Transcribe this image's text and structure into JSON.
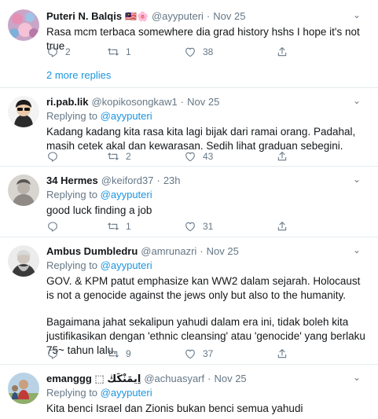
{
  "tweets": [
    {
      "name": "Puteri N. Balqis",
      "flags": "🇲🇾🌸",
      "handle": "@ayyputeri",
      "time": "Nov 25",
      "reply_label": "",
      "reply_to": "",
      "text": [
        "Rasa mcm terbaca somewhere dia grad history hshs I hope it's not true"
      ],
      "replies": "2",
      "retweets": "1",
      "likes": "38"
    },
    {
      "name": "ri.pab.lik",
      "handle": "@kopikosongkaw1",
      "time": "Nov 25",
      "reply_label": "Replying to",
      "reply_to": "@ayyputeri",
      "text": [
        "Kadang kadang kita rasa kita lagi bijak dari ramai orang. Padahal, masih cetek akal dan kewarasan. Sedih lihat graduan sebegini."
      ],
      "replies": "",
      "retweets": "2",
      "likes": "43"
    },
    {
      "name": "34 Hermes",
      "handle": "@keiford37",
      "time": "23h",
      "reply_label": "Replying to",
      "reply_to": "@ayyputeri",
      "text": [
        "good luck finding a job"
      ],
      "replies": "",
      "retweets": "1",
      "likes": "31"
    },
    {
      "name": "Ambus Dumbledru",
      "handle": "@amrunazri",
      "time": "Nov 25",
      "reply_label": "Replying to",
      "reply_to": "@ayyputeri",
      "text": [
        "GOV. & KPM patut emphasize kan WW2 dalam sejarah. Holocaust is not a genocide against the jews only but also to the humanity.",
        "Bagaimana jahat sekalipun yahudi dalam era ini, tidak boleh kita justifikasikan dengan 'ethnic cleansing' atau 'genocide' yang berlaku 75~ tahun lalu."
      ],
      "replies": "",
      "retweets": "9",
      "likes": "37"
    },
    {
      "name": "emanggg ⬚ اِيمَنْكَڬ",
      "handle": "@achuasyarf",
      "time": "Nov 25",
      "reply_label": "Replying to",
      "reply_to": "@ayyputeri",
      "text": [
        "Kita benci Israel dan Zionis bukan benci semua yahudi"
      ],
      "replies": "",
      "retweets": "",
      "likes": ""
    }
  ],
  "more_replies": "2 more replies",
  "dot": "·",
  "colors": {
    "link": "#1b95e0",
    "muted": "#657786",
    "divider": "#e6ecf0"
  }
}
